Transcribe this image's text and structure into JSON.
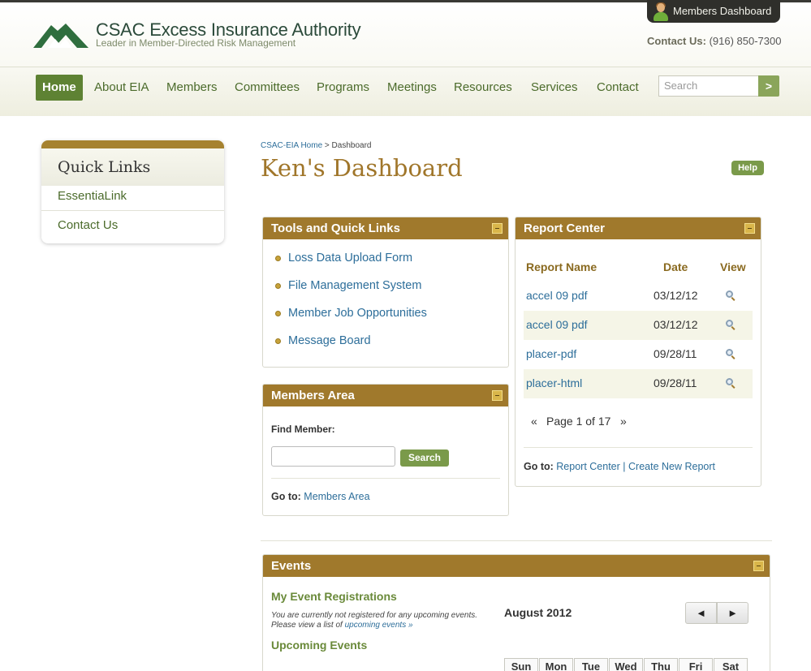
{
  "header": {
    "brand_title": "CSAC Excess Insurance Authority",
    "brand_subtitle": "Leader in Member-Directed Risk Management",
    "members_tab_label": "Members Dashboard",
    "contact_label": "Contact Us:",
    "contact_phone": "(916) 850-7300",
    "logo_icon": "eia-mountain-logo"
  },
  "nav": {
    "items": [
      "Home",
      "About EIA",
      "Members",
      "Committees",
      "Programs",
      "Meetings",
      "Resources",
      "Services",
      "Contact"
    ],
    "active": "Home",
    "search_placeholder": "Search",
    "search_go": ">"
  },
  "sidebar": {
    "title": "Quick Links",
    "items": [
      "EssentiaLink",
      "Contact Us"
    ]
  },
  "breadcrumb": {
    "home": "CSAC-EIA Home",
    "sep": ">",
    "current": "Dashboard"
  },
  "page": {
    "title": "Ken's Dashboard",
    "help_label": "Help"
  },
  "tools": {
    "title": "Tools and Quick Links",
    "links": [
      "Loss Data Upload Form",
      "File Management System",
      "Member Job Opportunities",
      "Message Board"
    ]
  },
  "members_area": {
    "title": "Members Area",
    "find_label": "Find Member:",
    "search_button": "Search",
    "goto_label": "Go to:",
    "goto_link": "Members Area"
  },
  "report_center": {
    "title": "Report Center",
    "columns": [
      "Report Name",
      "Date",
      "View"
    ],
    "rows": [
      {
        "name": "accel 09 pdf",
        "date": "03/12/12"
      },
      {
        "name": "accel 09 pdf",
        "date": "03/12/12"
      },
      {
        "name": "placer-pdf",
        "date": "09/28/11"
      },
      {
        "name": "placer-html",
        "date": "09/28/11"
      }
    ],
    "pager_prev": "«",
    "pager_text": "Page 1 of 17",
    "pager_next": "»",
    "goto_label": "Go to:",
    "goto_link1": "Report Center",
    "goto_sep": "|",
    "goto_link2": "Create New Report"
  },
  "events": {
    "title": "Events",
    "my_reg_title": "My Event Registrations",
    "note_line1": "You are currently not registered for any upcoming events.",
    "note_line2": "Please view a list of",
    "note_link": "upcoming events »",
    "upcoming_title": "Upcoming Events",
    "calendar_month": "August 2012",
    "prev": "◄",
    "next": "►",
    "days": [
      "Sun",
      "Mon",
      "Tue",
      "Wed",
      "Thu",
      "Fri",
      "Sat"
    ]
  },
  "colors": {
    "panel_header": "#a0792c",
    "nav_active": "#5e8233",
    "link": "#2d6e9a",
    "title": "#a0762a"
  }
}
